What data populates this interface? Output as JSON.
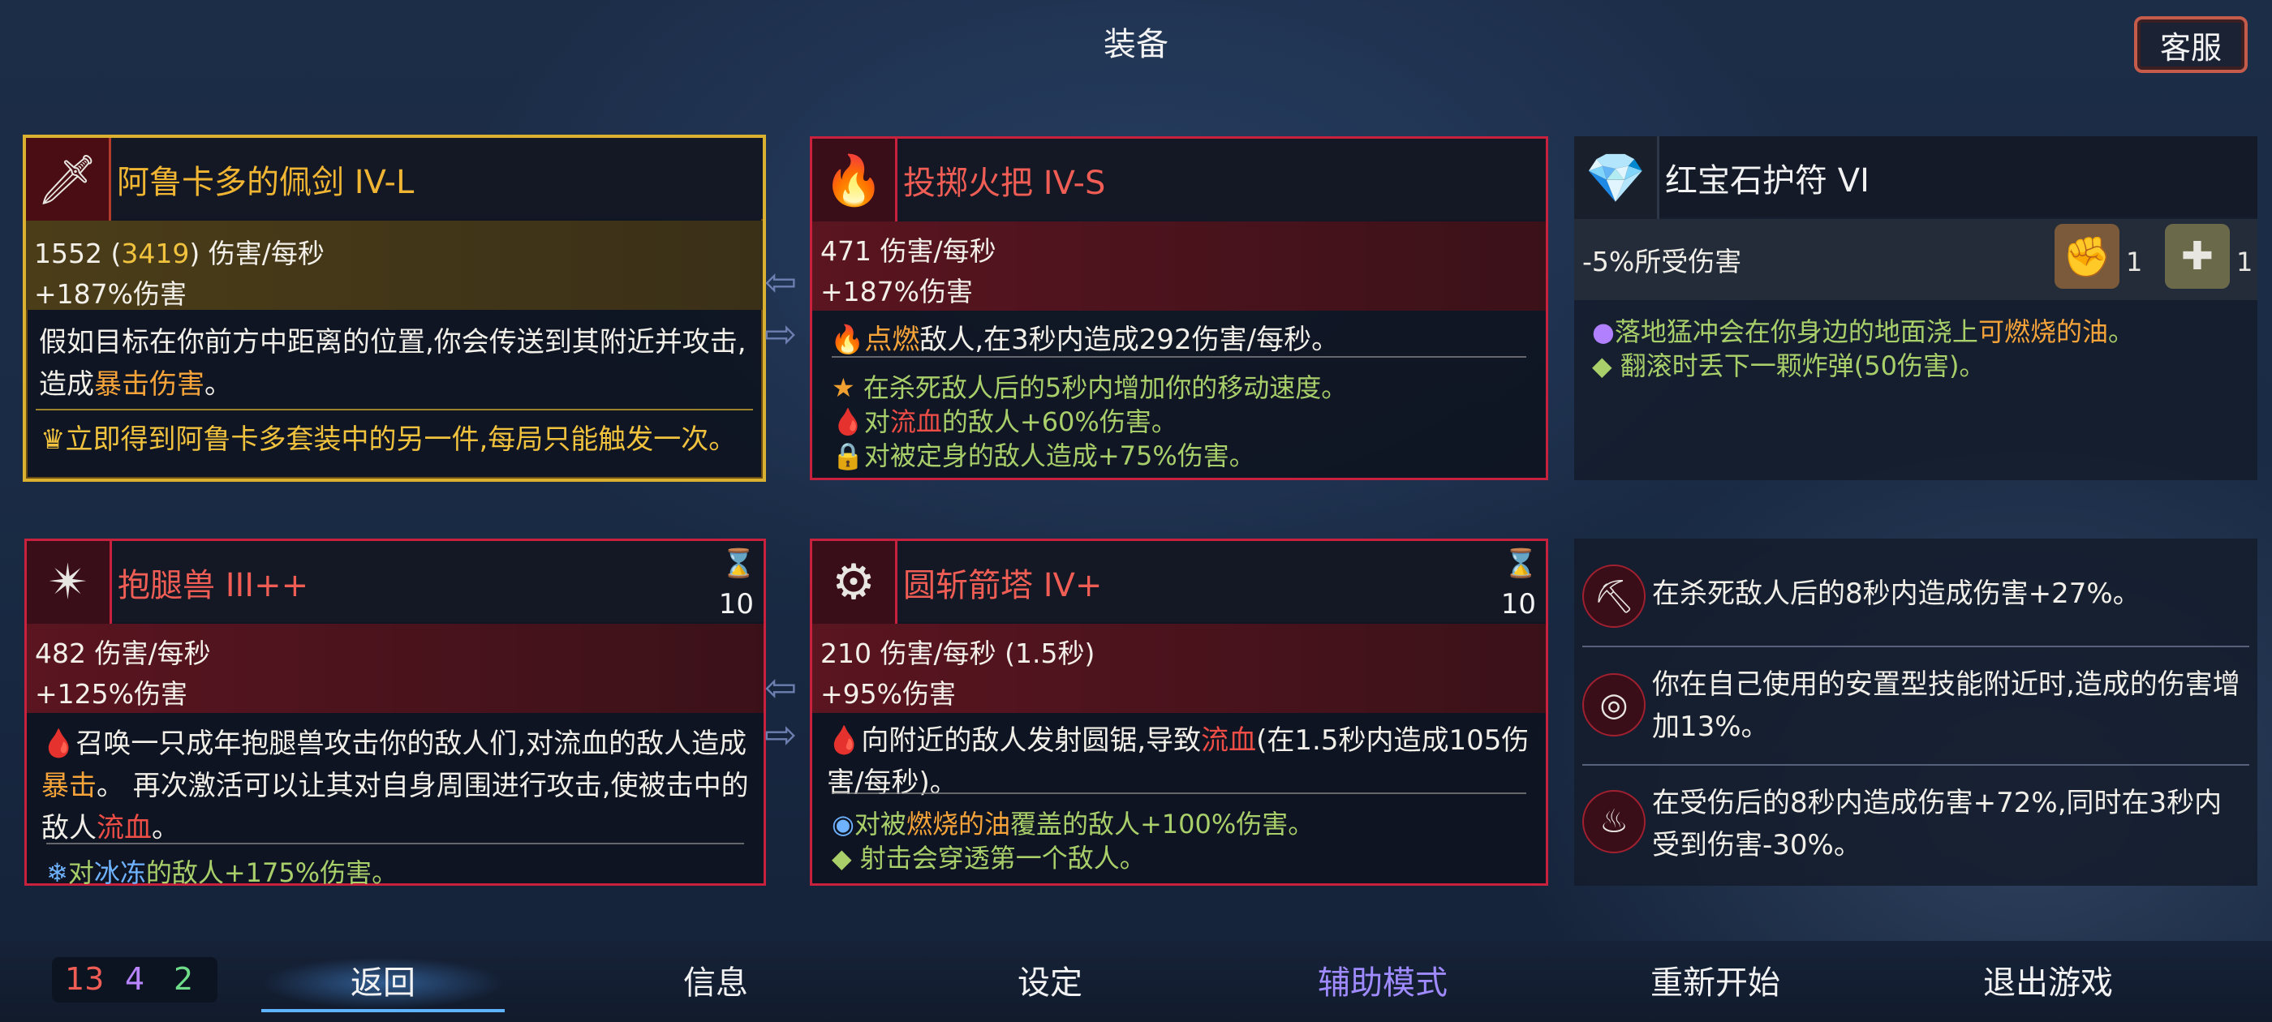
{
  "header": {
    "title": "装备",
    "service_button": "客服"
  },
  "weapon1": {
    "title": "阿鲁卡多的佩剑 IV-L",
    "dps_base": "1552 (",
    "dps_bonus": "3419",
    "dps_suffix": ") 伤害/每秒",
    "stat2": "+187%伤害",
    "desc_a": "假如目标在你前方中距离的位置,你会传送到其附近并攻击,造成",
    "desc_hl": "暴击伤害",
    "desc_end": "。",
    "gold_text": "立即得到阿鲁卡多套装中的另一件,每局只能触发一次。"
  },
  "weapon2": {
    "title": "投掷火把 IV-S",
    "stat1": "471 伤害/每秒",
    "stat2": "+187%伤害",
    "desc_hl": "点燃",
    "desc_rest": "敌人,在3秒内造成292伤害/每秒。",
    "line1": "在杀死敌人后的5秒内增加你的移动速度。",
    "line2_a": "对",
    "line2_hl": "流血",
    "line2_b": "的敌人+60%伤害。",
    "line3": "对被定身的敌人造成+75%伤害。"
  },
  "amulet": {
    "title": "红宝石护符 VI",
    "stat": "-5%所受伤害",
    "scroll1_count": "1",
    "scroll2_count": "1",
    "line1_a": "落地猛冲会在你身边的地面浇上",
    "line1_hl": "可燃烧的油",
    "line1_b": "。",
    "line2": "翻滚时丢下一颗炸弹(50伤害)。"
  },
  "skill1": {
    "title": "抱腿兽 III++",
    "count": "10",
    "stat1": "482 伤害/每秒",
    "stat2": "+125%伤害",
    "desc_a": "召唤一只成年抱腿兽攻击你的敌人们,对流血的敌人造成",
    "desc_hl1": "暴击",
    "desc_b": "。 再次激活可以让其对自身周围进行攻击,使被击中的敌人",
    "desc_hl2": "流血",
    "desc_c": "。",
    "line1_a": "对",
    "line1_hl": "冰冻",
    "line1_b": "的敌人+175%伤害。"
  },
  "skill2": {
    "title": "圆斩箭塔 IV+",
    "count": "10",
    "stat1": "210 伤害/每秒 (1.5秒)",
    "stat2": "+95%伤害",
    "desc_a": "向附近的敌人发射圆锯,导致",
    "desc_hl": "流血",
    "desc_b": "(在1.5秒内造成105伤害/每秒)。",
    "line1_a": "对被",
    "line1_hl": "燃烧的油",
    "line1_b": "覆盖的敌人+100%伤害。",
    "line2": "射击会穿透第一个敌人。"
  },
  "mutations": [
    {
      "text": "在杀死敌人后的8秒内造成伤害+27%。"
    },
    {
      "text": "你在自己使用的安置型技能附近时,造成的伤害增加13%。"
    },
    {
      "text": "在受伤后的8秒内造成伤害+72%,同时在3秒内受到伤害-30%。"
    }
  ],
  "scrolls": {
    "red": "13",
    "purple": "4",
    "green": "2"
  },
  "nav": [
    "返回",
    "信息",
    "设定",
    "辅助模式",
    "重新开始",
    "退出游戏"
  ],
  "colors": {
    "accent_red": "#c8213d",
    "legendary_gold": "#d9b02f",
    "assist_purple": "#9f8bff",
    "active_blue": "#5fb4ff"
  }
}
